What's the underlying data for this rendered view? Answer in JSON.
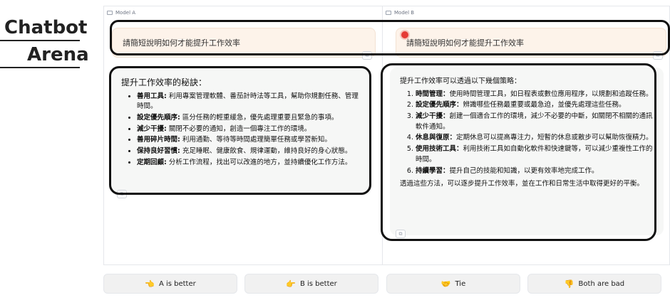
{
  "brand": {
    "line1": "Chatbot",
    "line2": "Arena"
  },
  "model_a": {
    "label": "Model A",
    "prompt": "請簡短說明如何才能提升工作效率",
    "reply": {
      "title": "提升工作效率的秘訣：",
      "items": [
        {
          "bold": "善用工具:",
          "text": " 利用專案管理軟體、番茄計時法等工具，幫助你規劃任務、管理時間。"
        },
        {
          "bold": "設定優先順序:",
          "text": " 區分任務的輕重緩急，優先處理重要且緊急的事項。"
        },
        {
          "bold": "減少干擾:",
          "text": " 關閉不必要的通知，創造一個專注工作的環境。"
        },
        {
          "bold": "善用碎片時間:",
          "text": " 利用通勤、等待等時間處理簡單任務或學習新知。"
        },
        {
          "bold": "保持良好習慣:",
          "text": " 充足睡眠、健康飲食、規律運動，維持良好的身心狀態。"
        },
        {
          "bold": "定期回顧:",
          "text": " 分析工作流程，找出可以改進的地方，並持續優化工作方法。"
        }
      ]
    }
  },
  "model_b": {
    "label": "Model B",
    "prompt": "請簡短說明如何才能提升工作效率",
    "reply": {
      "title": "提升工作效率可以透過以下幾個策略：",
      "items": [
        {
          "bold": "時間管理：",
          "text": "使用時間管理工具，如日程表或數位應用程序，以規劃和追蹤任務。"
        },
        {
          "bold": "設定優先順序：",
          "text": "辨識哪些任務最重要或最急迫，並優先處理這些任務。"
        },
        {
          "bold": "減少干擾：",
          "text": "創建一個適合工作的環境，減少不必要的中斷，如關閉不相關的通訊軟件通知。"
        },
        {
          "bold": "休息與復原：",
          "text": "定期休息可以提高專注力，短暫的休息或散步可以幫助恢復精力。"
        },
        {
          "bold": "使用技術工具：",
          "text": "利用技術工具如自動化軟件和快速鍵等，可以減少重複性工作的時間。"
        },
        {
          "bold": "持續學習：",
          "text": "提升自己的技能和知識，以更有效率地完成工作。"
        }
      ],
      "footer": "透過這些方法，可以逐步提升工作效率，並在工作和日常生活中取得更好的平衡。"
    }
  },
  "votes": [
    {
      "icon": "👈",
      "label": "A is better"
    },
    {
      "icon": "👉",
      "label": "B is better"
    },
    {
      "icon": "🤝",
      "label": "Tie"
    },
    {
      "icon": "👎",
      "label": "Both are bad"
    }
  ]
}
